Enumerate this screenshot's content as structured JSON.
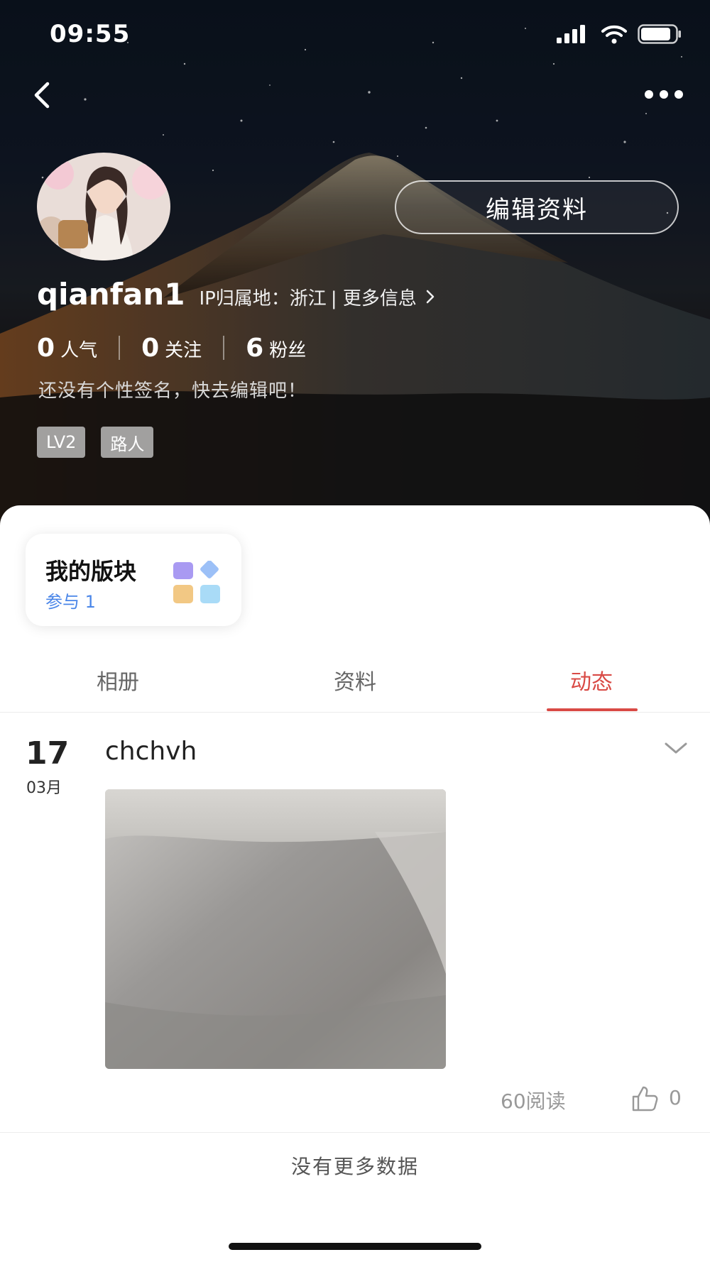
{
  "status_bar": {
    "time": "09:55"
  },
  "header": {
    "back_icon": "chevron-left-icon",
    "more_icon": "ellipsis-icon",
    "edit_label": "编辑资料"
  },
  "profile": {
    "username": "qianfan1",
    "ip_location": "IP归属地：浙江",
    "more_info": "| 更多信息",
    "stats": [
      {
        "num": "0",
        "label": "人气"
      },
      {
        "num": "0",
        "label": "关注"
      },
      {
        "num": "6",
        "label": "粉丝"
      }
    ],
    "signature": "还没有个性签名，快去编辑吧！",
    "tags": [
      "LV2",
      "路人"
    ]
  },
  "board": {
    "title": "我的版块",
    "subtitle": "参与 1"
  },
  "tabs": [
    {
      "label": "相册",
      "active": false
    },
    {
      "label": "资料",
      "active": false
    },
    {
      "label": "动态",
      "active": true
    }
  ],
  "post": {
    "day": "17",
    "month": "03月",
    "title": "chchvh",
    "reads": "60阅读",
    "likes": "0"
  },
  "footer": {
    "no_more": "没有更多数据"
  },
  "colors": {
    "accent": "#d94a45",
    "link_blue": "#4a86e8"
  }
}
